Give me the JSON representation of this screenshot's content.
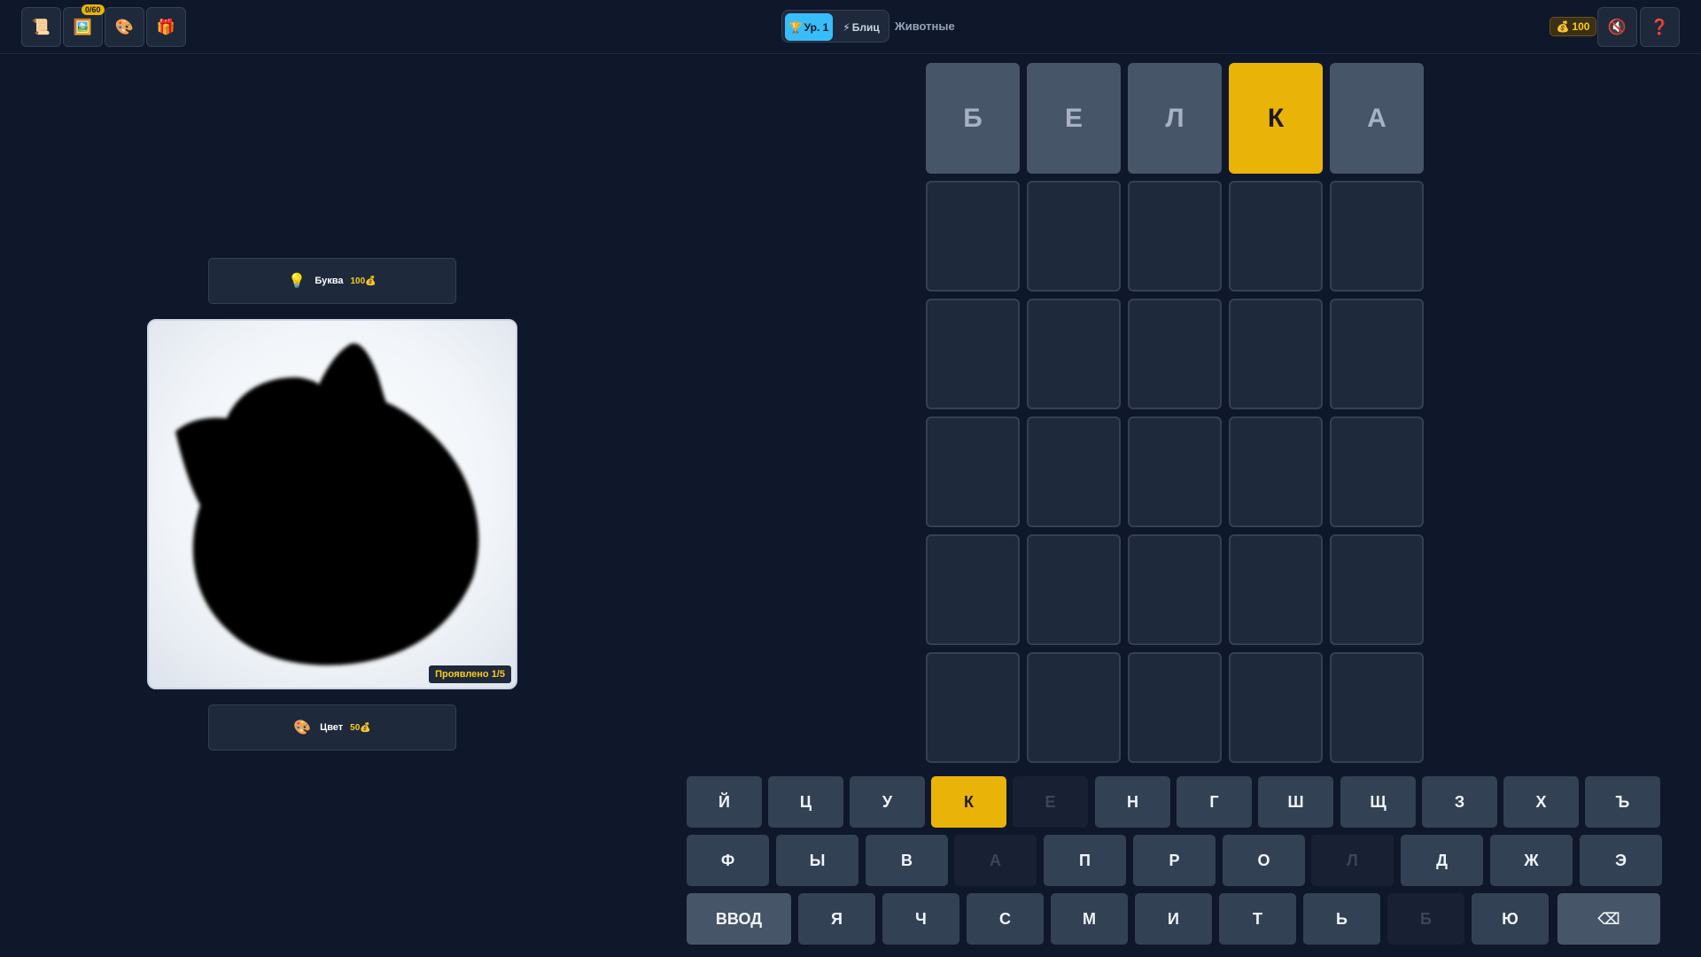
{
  "toolbar": {
    "scroll_icon": "📜",
    "gallery_icon": "🖼️",
    "gallery_badge": "0/60",
    "palette_icon": "🎨",
    "gift_icon": "🎁",
    "mute_icon": "🔇",
    "help_icon": "❓"
  },
  "modes": {
    "level_icon": "🏆",
    "level_label": "Ур. 1",
    "blitz_icon": "⚡",
    "blitz_label": "Блиц",
    "active": "level"
  },
  "category": "Животные",
  "coins": {
    "icon": "💰",
    "amount": "100"
  },
  "hints": {
    "letter": {
      "icon": "💡",
      "label": "Буква",
      "cost": "100💰"
    },
    "color": {
      "icon": "🎨",
      "label": "Цвет",
      "cost": "50💰"
    }
  },
  "picture": {
    "revealed_label": "Проявлено 1/5",
    "revealed_count": 1,
    "revealed_total": 5
  },
  "board": {
    "rows": 6,
    "cols": 5,
    "guesses": [
      [
        {
          "letter": "Б",
          "state": "absent"
        },
        {
          "letter": "Е",
          "state": "absent"
        },
        {
          "letter": "Л",
          "state": "absent"
        },
        {
          "letter": "К",
          "state": "present"
        },
        {
          "letter": "А",
          "state": "absent"
        }
      ]
    ]
  },
  "keyboard": {
    "rows": [
      [
        {
          "label": "Й"
        },
        {
          "label": "Ц"
        },
        {
          "label": "У"
        },
        {
          "label": "К",
          "state": "present"
        },
        {
          "label": "Е",
          "state": "disabled"
        },
        {
          "label": "Н"
        },
        {
          "label": "Г"
        },
        {
          "label": "Ш"
        },
        {
          "label": "Щ"
        },
        {
          "label": "З"
        },
        {
          "label": "Х"
        },
        {
          "label": "Ъ"
        }
      ],
      [
        {
          "label": "Ф"
        },
        {
          "label": "Ы"
        },
        {
          "label": "В"
        },
        {
          "label": "А",
          "state": "disabled"
        },
        {
          "label": "П"
        },
        {
          "label": "Р"
        },
        {
          "label": "О"
        },
        {
          "label": "Л",
          "state": "disabled"
        },
        {
          "label": "Д"
        },
        {
          "label": "Ж"
        },
        {
          "label": "Э"
        }
      ],
      [
        {
          "label": "ВВОД",
          "action": "enter"
        },
        {
          "label": "Я"
        },
        {
          "label": "Ч"
        },
        {
          "label": "С"
        },
        {
          "label": "М"
        },
        {
          "label": "И"
        },
        {
          "label": "Т"
        },
        {
          "label": "Ь"
        },
        {
          "label": "Б",
          "state": "disabled"
        },
        {
          "label": "Ю"
        },
        {
          "label": "⌫",
          "action": "backspace"
        }
      ]
    ]
  },
  "colors": {
    "background": "#0f172a",
    "tile_empty": "#1e293b",
    "tile_absent": "#475569",
    "present": "#eab308",
    "key": "#334155",
    "accent": "#38bdf8"
  }
}
